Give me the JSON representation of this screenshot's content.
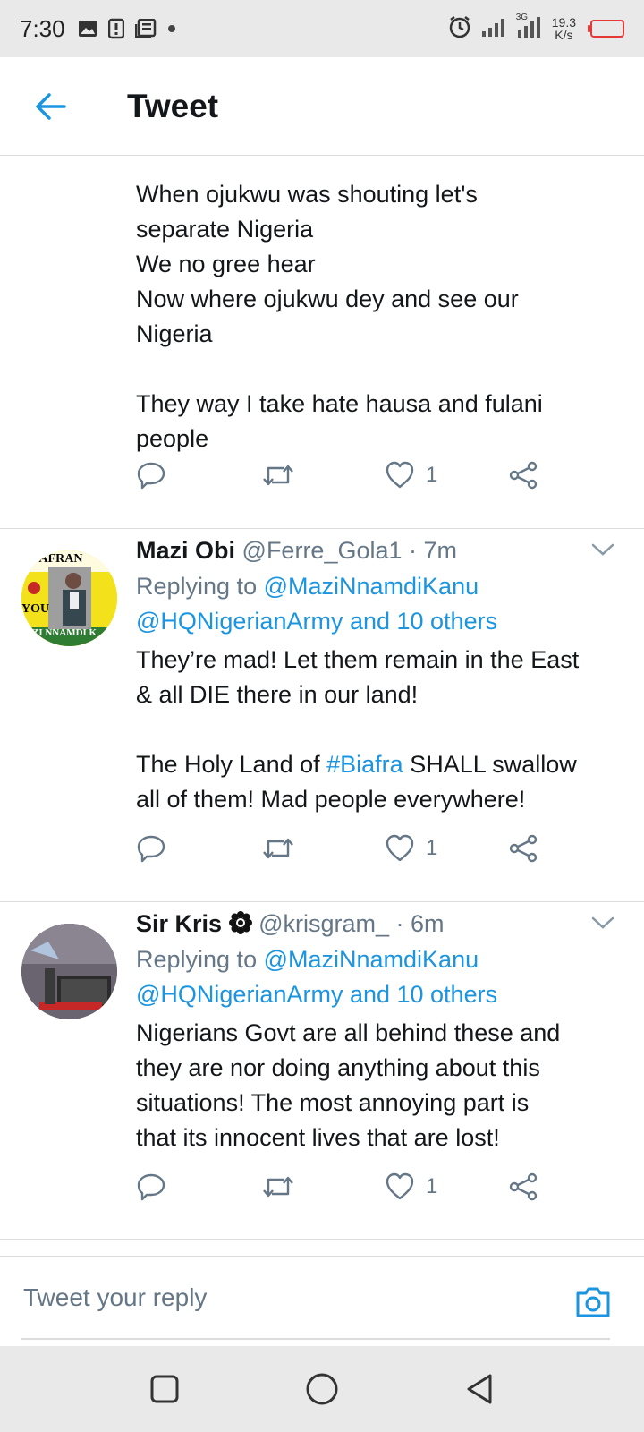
{
  "status_bar": {
    "time": "7:30",
    "net_speed_value": "19.3",
    "net_speed_unit": "K/s",
    "network_label": "3G"
  },
  "header": {
    "title": "Tweet"
  },
  "tweets": [
    {
      "text": "When ojukwu was shouting let's\nseparate Nigeria\nWe no gree hear\nNow where ojukwu dey and see our\nNigeria\n\nThey way I take hate hausa and fulani\npeople",
      "likes": "1"
    },
    {
      "name": "Mazi Obi",
      "handle": "@Ferre_Gola1",
      "time": "· 7m",
      "replying_prefix": "Replying to ",
      "replying_mention": "@MaziNnamdiKanu",
      "replying_rest": "@HQNigerianArmy and 10 others",
      "text_1": "They’re mad! Let them remain in the East\n& all DIE there in our land!\n\nThe Holy Land of ",
      "hashtag": "#Biafra",
      "text_2": " SHALL swallow\nall of them! Mad people everywhere!",
      "likes": "1",
      "avatar_text_top": "IAFRAN",
      "avatar_text_mid": "YOU",
      "avatar_text_bottom": "ZI NNAMDI K"
    },
    {
      "name": "Sir Kris",
      "handle": "@krisgram_",
      "time": "· 6m",
      "replying_prefix": "Replying to ",
      "replying_mention": "@MaziNnamdiKanu",
      "replying_rest": "@HQNigerianArmy and 10 others",
      "text": "Nigerians Govt are all behind these and\nthey are nor doing anything about this\nsituations! The most annoying part is\nthat its innocent lives that are lost!",
      "likes": "1"
    }
  ],
  "reply_bar": {
    "placeholder": "Tweet your reply"
  },
  "icons": {
    "accent": "#1b95e0",
    "reply": "reply-icon",
    "retweet": "retweet-icon",
    "like": "heart-icon",
    "share": "share-icon",
    "camera": "camera-icon",
    "back": "back-arrow-icon"
  }
}
